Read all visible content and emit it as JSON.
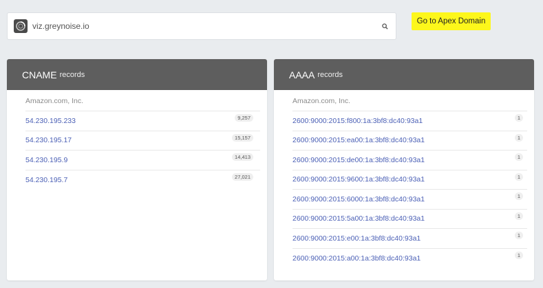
{
  "search": {
    "value": "viz.greynoise.io"
  },
  "apex_button": {
    "label": "Go to Apex Domain"
  },
  "colors": {
    "accent_yellow": "#fdf71b",
    "header_gray": "#5e5e5e",
    "link_blue": "#4a5fb5"
  },
  "icons": {
    "favicon": "greynoise-logo-icon",
    "search": "search-icon"
  },
  "cname_panel": {
    "type": "CNAME",
    "suffix": "records",
    "org": "Amazon.com, Inc.",
    "records": [
      {
        "value": "54.230.195.233",
        "count": "9,257"
      },
      {
        "value": "54.230.195.17",
        "count": "15,157"
      },
      {
        "value": "54.230.195.9",
        "count": "14,413"
      },
      {
        "value": "54.230.195.7",
        "count": "27,021"
      }
    ]
  },
  "aaaa_panel": {
    "type": "AAAA",
    "suffix": "records",
    "org": "Amazon.com, Inc.",
    "records": [
      {
        "value": "2600:9000:2015:f800:1a:3bf8:dc40:93a1",
        "count": "1"
      },
      {
        "value": "2600:9000:2015:ea00:1a:3bf8:dc40:93a1",
        "count": "1"
      },
      {
        "value": "2600:9000:2015:de00:1a:3bf8:dc40:93a1",
        "count": "1"
      },
      {
        "value": "2600:9000:2015:9600:1a:3bf8:dc40:93a1",
        "count": "1"
      },
      {
        "value": "2600:9000:2015:6000:1a:3bf8:dc40:93a1",
        "count": "1"
      },
      {
        "value": "2600:9000:2015:5a00:1a:3bf8:dc40:93a1",
        "count": "1"
      },
      {
        "value": "2600:9000:2015:e00:1a:3bf8:dc40:93a1",
        "count": "1"
      },
      {
        "value": "2600:9000:2015:a00:1a:3bf8:dc40:93a1",
        "count": "1"
      }
    ]
  }
}
